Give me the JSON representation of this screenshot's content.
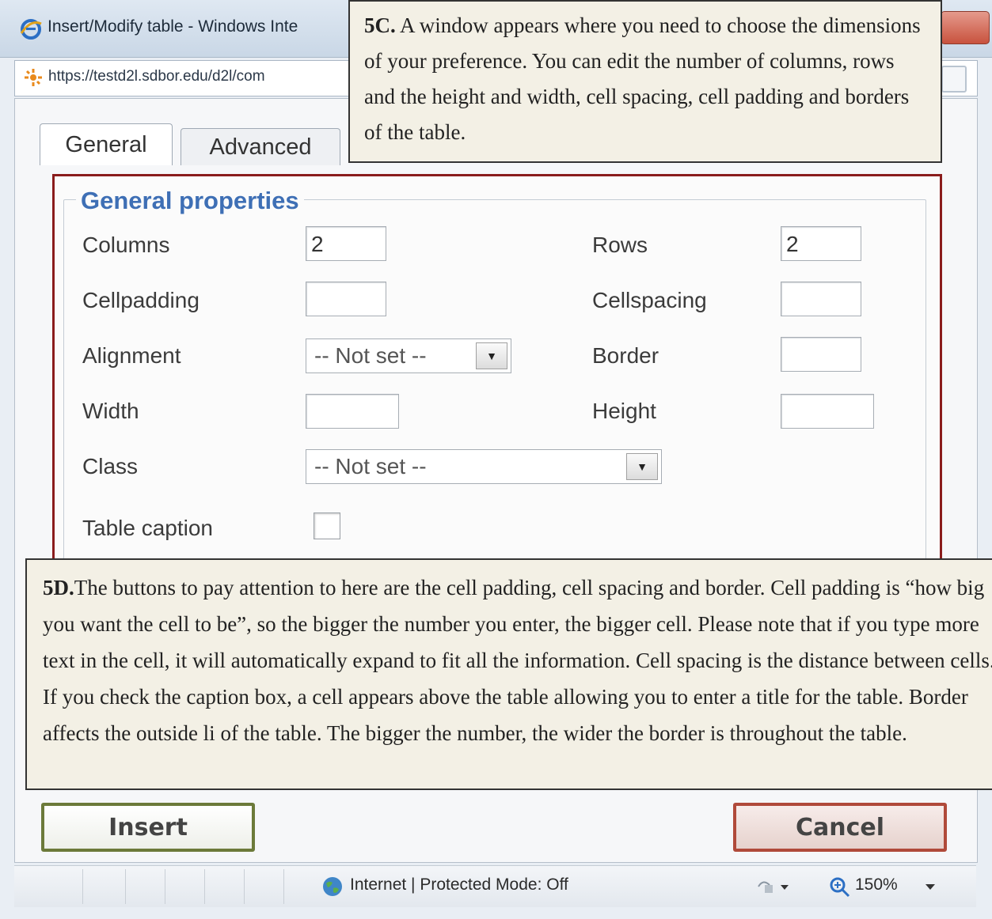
{
  "window": {
    "title": "Insert/Modify table - Windows Inte",
    "url": "https://testd2l.sdbor.edu/d2l/com"
  },
  "tabs": [
    {
      "label": "General",
      "active": true
    },
    {
      "label": "Advanced",
      "active": false
    }
  ],
  "general_properties": {
    "legend": "General properties",
    "columns_label": "Columns",
    "columns_value": "2",
    "rows_label": "Rows",
    "rows_value": "2",
    "cellpadding_label": "Cellpadding",
    "cellpadding_value": "",
    "cellspacing_label": "Cellspacing",
    "cellspacing_value": "",
    "alignment_label": "Alignment",
    "alignment_value": "-- Not set --",
    "border_label": "Border",
    "border_value": "",
    "width_label": "Width",
    "width_value": "",
    "height_label": "Height",
    "height_value": "",
    "class_label": "Class",
    "class_value": "-- Not set --",
    "caption_label": "Table caption",
    "caption_checked": false
  },
  "buttons": {
    "insert": "Insert",
    "cancel": "Cancel"
  },
  "statusbar": {
    "zone": "Internet | Protected Mode: Off",
    "zoom": "150%"
  },
  "callouts": {
    "c5c_head": "5C.",
    "c5c_body": " A window appears where you need to choose the dimensions of your preference. You can edit the number of columns, rows and the height and width, cell spacing, cell padding and borders of the table.",
    "c5d_head": "5D.",
    "c5d_body": "The buttons to pay attention to here are the cell padding, cell spacing and border. Cell padding is “how big you want the cell to be”, so the bigger the number you enter, the bigger cell. Please note that if you type more text in the cell, it will automatically expand to fit all the information. Cell spacing is the distance between cells. If you check the caption box, a cell appears above the table allowing you to enter a title for the table. Border affects the outside li of the table. The bigger the number, the wider the border is throughout the table."
  },
  "colors": {
    "panel_border": "#8a1c1c",
    "legend": "#3e6fb5",
    "insert_border": "#6c7a3a",
    "cancel_border": "#b04a3a"
  }
}
